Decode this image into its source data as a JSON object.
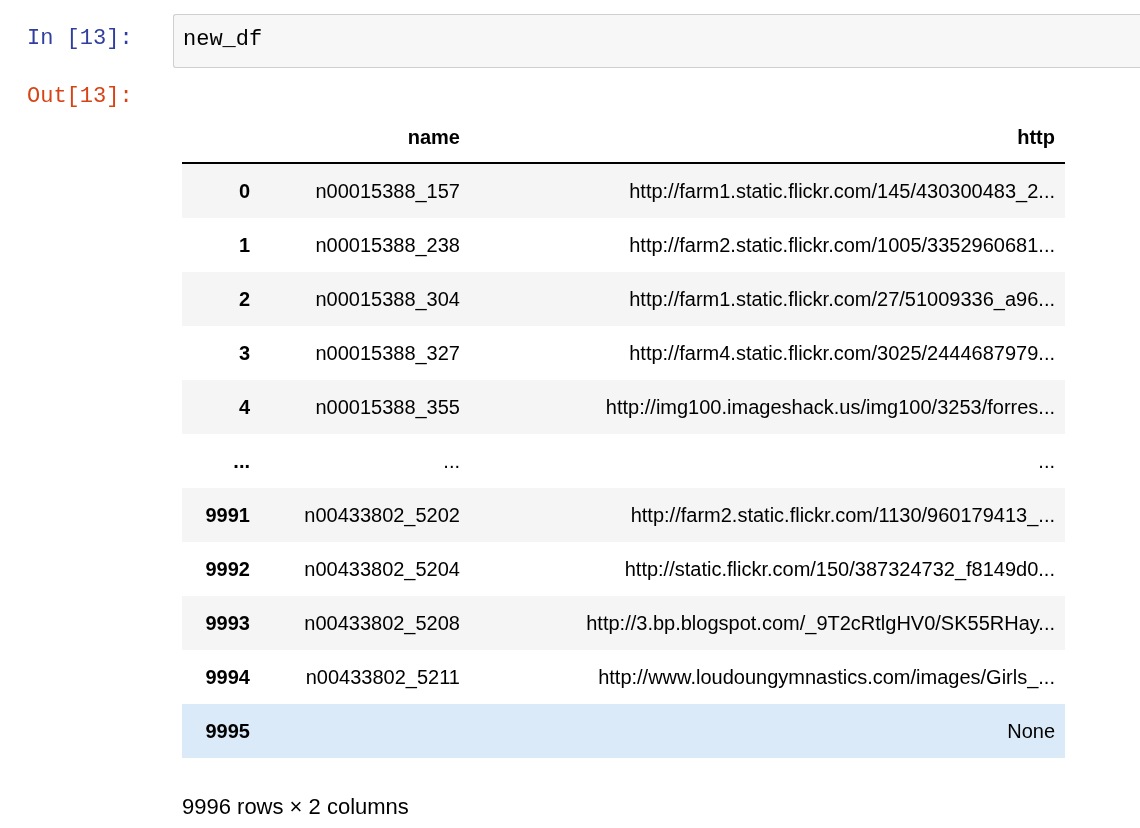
{
  "cell": {
    "input_prompt": "In [13]:",
    "code": "new_df",
    "output_prompt": "Out[13]:"
  },
  "table": {
    "columns": [
      "name",
      "http"
    ],
    "rows": [
      {
        "index": "0",
        "name": "n00015388_157",
        "http": "http://farm1.static.flickr.com/145/430300483_2...",
        "hovered": false
      },
      {
        "index": "1",
        "name": "n00015388_238",
        "http": "http://farm2.static.flickr.com/1005/3352960681...",
        "hovered": false
      },
      {
        "index": "2",
        "name": "n00015388_304",
        "http": "http://farm1.static.flickr.com/27/51009336_a96...",
        "hovered": false
      },
      {
        "index": "3",
        "name": "n00015388_327",
        "http": "http://farm4.static.flickr.com/3025/2444687979...",
        "hovered": false
      },
      {
        "index": "4",
        "name": "n00015388_355",
        "http": "http://img100.imageshack.us/img100/3253/forres...",
        "hovered": false
      },
      {
        "index": "...",
        "name": "...",
        "http": "...",
        "hovered": false
      },
      {
        "index": "9991",
        "name": "n00433802_5202",
        "http": "http://farm2.static.flickr.com/1130/960179413_...",
        "hovered": false
      },
      {
        "index": "9992",
        "name": "n00433802_5204",
        "http": "http://static.flickr.com/150/387324732_f8149d0...",
        "hovered": false
      },
      {
        "index": "9993",
        "name": "n00433802_5208",
        "http": "http://3.bp.blogspot.com/_9T2cRtlgHV0/SK55RHay...",
        "hovered": false
      },
      {
        "index": "9994",
        "name": "n00433802_5211",
        "http": "http://www.loudoungymnastics.com/images/Girls_...",
        "hovered": false
      },
      {
        "index": "9995",
        "name": "",
        "http": "None",
        "hovered": true
      }
    ]
  },
  "summary": "9996 rows × 2 columns"
}
